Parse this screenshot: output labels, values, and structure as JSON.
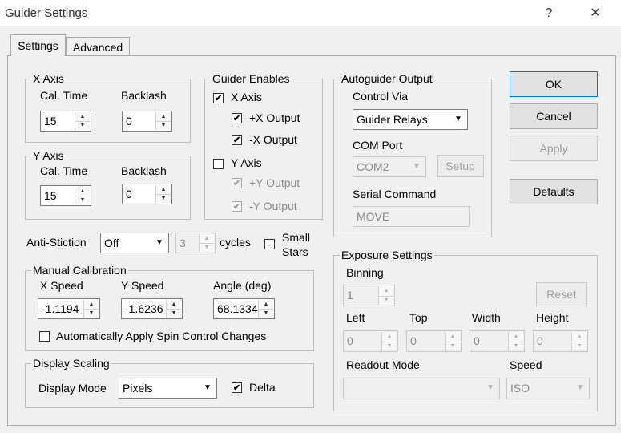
{
  "window": {
    "title": "Guider Settings",
    "help_glyph": "?",
    "close_glyph": "✕"
  },
  "tabs": [
    "Settings",
    "Advanced"
  ],
  "x_axis": {
    "title": "X Axis",
    "cal_time_label": "Cal. Time",
    "backlash_label": "Backlash",
    "cal_time": "15",
    "backlash": "0"
  },
  "y_axis": {
    "title": "Y Axis",
    "cal_time_label": "Cal. Time",
    "backlash_label": "Backlash",
    "cal_time": "15",
    "backlash": "0"
  },
  "guider_enables": {
    "title": "Guider Enables",
    "x_axis": {
      "label": "X Axis",
      "checked": true
    },
    "plus_x": {
      "label": "+X Output",
      "checked": true
    },
    "minus_x": {
      "label": "-X Output",
      "checked": true
    },
    "y_axis": {
      "label": "Y Axis",
      "checked": false
    },
    "plus_y": {
      "label": "+Y Output",
      "checked": true
    },
    "minus_y": {
      "label": "-Y Output",
      "checked": true
    }
  },
  "autoguider_output": {
    "title": "Autoguider Output",
    "control_via_label": "Control Via",
    "control_via": "Guider Relays",
    "com_port_label": "COM Port",
    "com_port": "COM2",
    "setup_label": "Setup",
    "serial_command_label": "Serial Command",
    "serial_command": "MOVE"
  },
  "buttons": {
    "ok": "OK",
    "cancel": "Cancel",
    "apply": "Apply",
    "defaults": "Defaults"
  },
  "anti_stiction": {
    "label": "Anti-Stiction",
    "mode": "Off",
    "cycles_value": "3",
    "cycles_label": "cycles",
    "small_stars_line1": "Small",
    "small_stars_line2": "Stars"
  },
  "manual_calibration": {
    "title": "Manual Calibration",
    "x_speed_label": "X Speed",
    "x_speed": "-1.1194",
    "y_speed_label": "Y Speed",
    "y_speed": "-1.6236",
    "angle_label": "Angle (deg)",
    "angle": "68.1334",
    "auto_apply_label": "Automatically Apply Spin Control Changes"
  },
  "display_scaling": {
    "title": "Display Scaling",
    "mode_label": "Display Mode",
    "mode": "Pixels",
    "delta_label": "Delta",
    "delta_checked": true
  },
  "exposure_settings": {
    "title": "Exposure Settings",
    "binning_label": "Binning",
    "binning": "1",
    "reset_label": "Reset",
    "left_label": "Left",
    "left": "0",
    "top_label": "Top",
    "top": "0",
    "width_label": "Width",
    "width": "0",
    "height_label": "Height",
    "height": "0",
    "readout_mode_label": "Readout Mode",
    "readout_mode": "",
    "speed_label": "Speed",
    "speed": "ISO"
  },
  "icons": {
    "check": "✔",
    "spin_up": "▲",
    "spin_down": "▼",
    "dropdown": "▼"
  }
}
